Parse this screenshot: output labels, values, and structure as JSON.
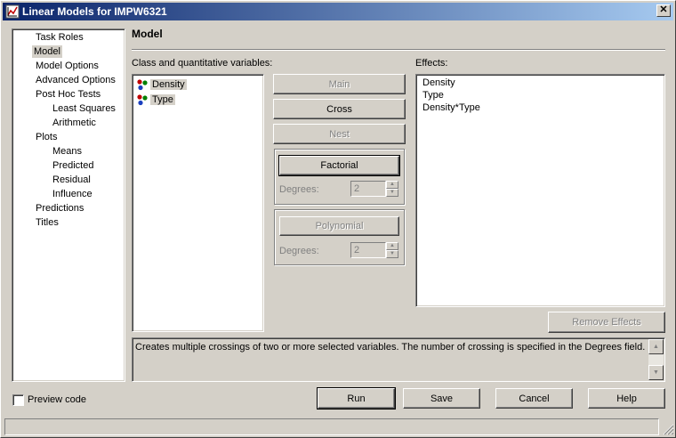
{
  "window": {
    "title": "Linear Models for IMPW6321",
    "close_label": "✕"
  },
  "nav": {
    "items": [
      {
        "label": "Task Roles",
        "indent": 0
      },
      {
        "label": "Model",
        "indent": 0,
        "selected": true
      },
      {
        "label": "Model Options",
        "indent": 0
      },
      {
        "label": "Advanced Options",
        "indent": 0
      },
      {
        "label": "Post Hoc Tests",
        "indent": 0
      },
      {
        "label": "Least Squares",
        "indent": 1
      },
      {
        "label": "Arithmetic",
        "indent": 1
      },
      {
        "label": "Plots",
        "indent": 0
      },
      {
        "label": "Means",
        "indent": 1
      },
      {
        "label": "Predicted",
        "indent": 1
      },
      {
        "label": "Residual",
        "indent": 1
      },
      {
        "label": "Influence",
        "indent": 1
      },
      {
        "label": "Predictions",
        "indent": 0
      },
      {
        "label": "Titles",
        "indent": 0
      }
    ]
  },
  "main": {
    "heading": "Model",
    "variables_label": "Class and quantitative variables:",
    "variables": [
      {
        "name": "Density",
        "icon": "classification-variable-icon"
      },
      {
        "name": "Type",
        "icon": "classification-variable-icon"
      }
    ],
    "buttons": {
      "main": "Main",
      "cross": "Cross",
      "nest": "Nest",
      "factorial": "Factorial",
      "polynomial": "Polynomial"
    },
    "factorial_degrees_label": "Degrees:",
    "factorial_degrees_value": "2",
    "polynomial_degrees_label": "Degrees:",
    "polynomial_degrees_value": "2",
    "effects_label": "Effects:",
    "effects": [
      "Density",
      "Type",
      "Density*Type"
    ],
    "remove_effects_label": "Remove Effects",
    "description": "Creates multiple crossings of two or more selected variables.  The number of crossing is specified in the Degrees field."
  },
  "footer": {
    "preview_code_label": "Preview code",
    "preview_code_checked": false,
    "run_label": "Run",
    "save_label": "Save",
    "cancel_label": "Cancel",
    "help_label": "Help"
  },
  "colors": {
    "dialog_bg": "#d4d0c8",
    "title_gradient_start": "#0a246a",
    "title_gradient_end": "#a6caf0",
    "disabled_text": "#808080"
  }
}
